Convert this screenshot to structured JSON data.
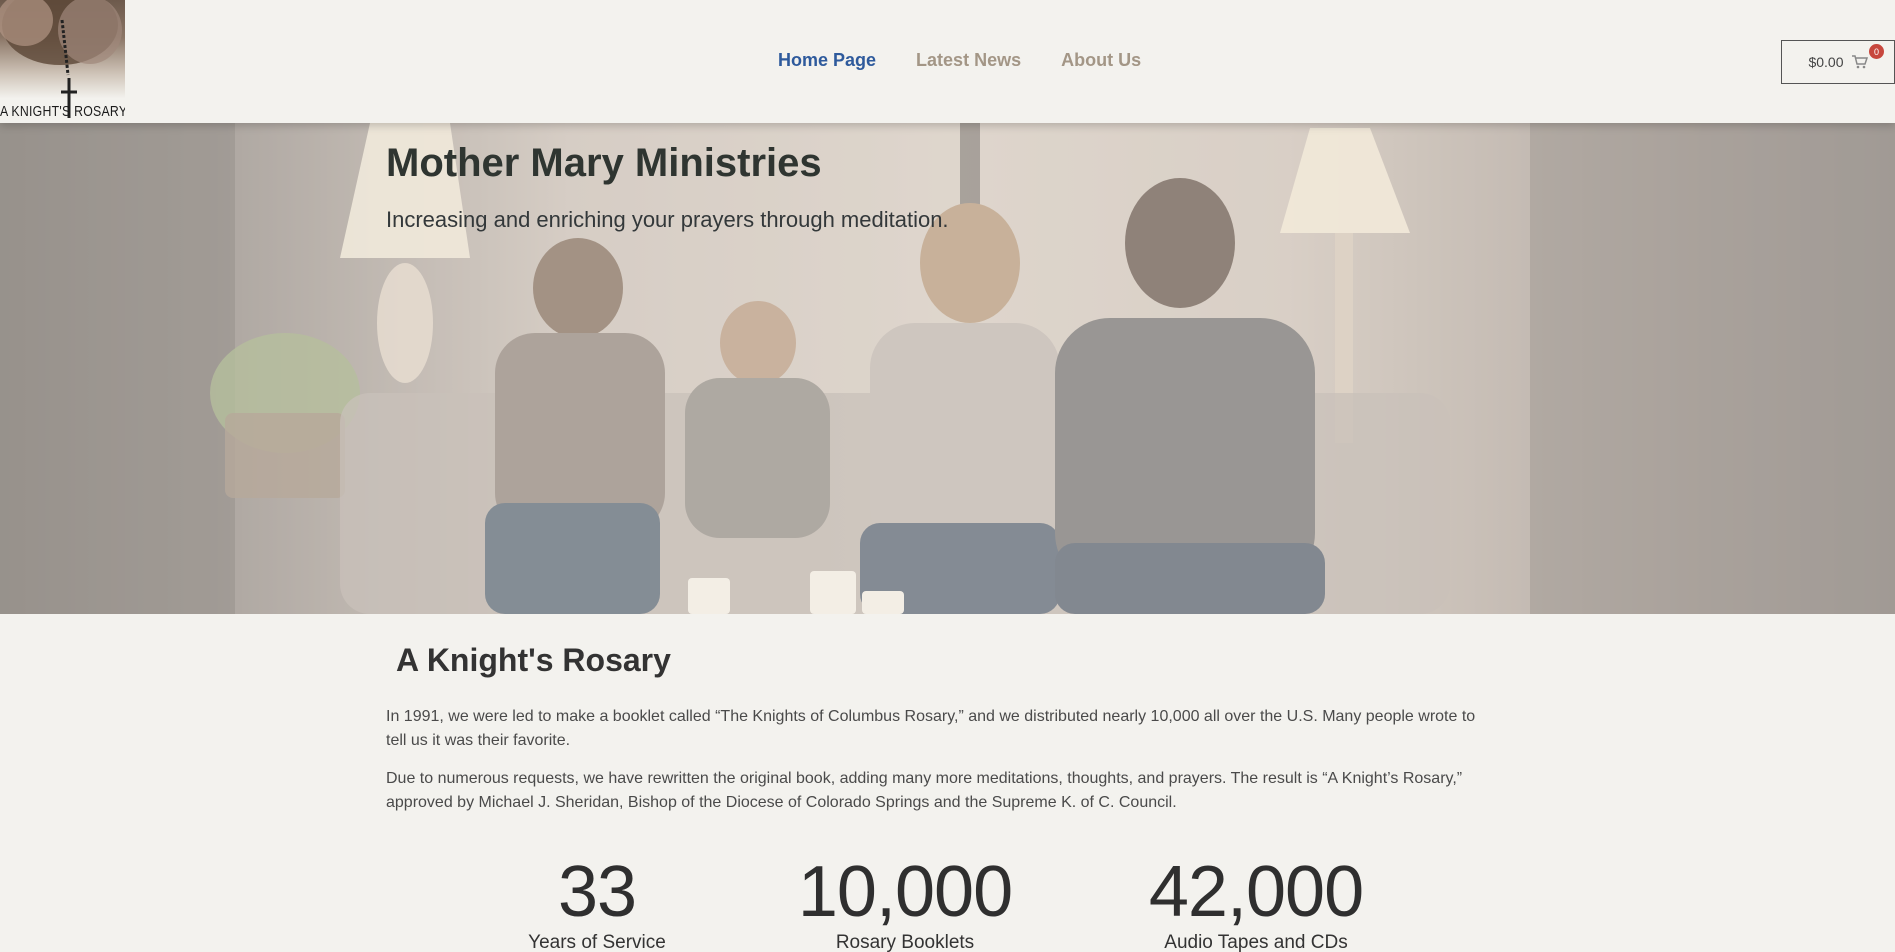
{
  "logo": {
    "text": "A KNIGHT'S ROSARY"
  },
  "nav": {
    "items": [
      {
        "label": "Home Page"
      },
      {
        "label": "Latest News"
      },
      {
        "label": "About Us"
      }
    ]
  },
  "cart": {
    "total": "$0.00",
    "count": "0"
  },
  "hero": {
    "title": "Mother Mary Ministries",
    "subtitle": "Increasing and enriching your prayers through meditation."
  },
  "intro": {
    "heading": "A Knight's Rosary",
    "paragraph1": "In 1991, we were led to make a booklet called “The Knights of Columbus Rosary,” and we distributed nearly 10,000 all over the U.S. Many people wrote to tell us it was their favorite.",
    "paragraph2": "Due to numerous requests, we have rewritten the original book, adding many more meditations, thoughts, and prayers.  The result is “A Knight’s Rosary,” approved by Michael J. Sheridan, Bishop of the Diocese of Colorado Springs and the Supreme K. of C. Council."
  },
  "stats": [
    {
      "number": "33",
      "label": "Years of Service"
    },
    {
      "number": "10,000",
      "label": "Rosary Booklets"
    },
    {
      "number": "42,000",
      "label": "Audio Tapes and CDs"
    }
  ],
  "colors": {
    "nav_active": "#2e5a9c",
    "nav_inactive": "#a39686",
    "badge": "#c7473d",
    "background": "#f3f2ee"
  }
}
